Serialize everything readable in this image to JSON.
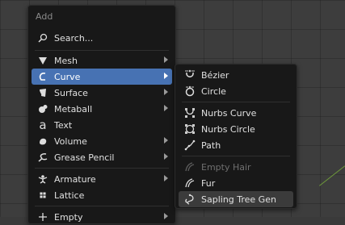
{
  "add_menu": {
    "header": "Add",
    "search_label": "Search...",
    "items": [
      {
        "label": "Mesh",
        "icon": "mesh-icon",
        "submenu": true
      },
      {
        "label": "Curve",
        "icon": "curve-icon",
        "submenu": true,
        "active": true
      },
      {
        "label": "Surface",
        "icon": "surface-icon",
        "submenu": true
      },
      {
        "label": "Metaball",
        "icon": "metaball-icon",
        "submenu": true
      },
      {
        "label": "Text",
        "icon": "text-icon",
        "submenu": false
      },
      {
        "label": "Volume",
        "icon": "volume-icon",
        "submenu": true
      },
      {
        "label": "Grease Pencil",
        "icon": "grease-pencil-icon",
        "submenu": true
      },
      {
        "label": "Armature",
        "icon": "armature-icon",
        "submenu": true
      },
      {
        "label": "Lattice",
        "icon": "lattice-icon",
        "submenu": false
      },
      {
        "label": "Empty",
        "icon": "empty-icon",
        "submenu": true
      }
    ]
  },
  "curve_menu": {
    "items": [
      {
        "label": "Bézier",
        "icon": "bezier-icon"
      },
      {
        "label": "Circle",
        "icon": "circle-curve-icon"
      },
      {
        "label": "Nurbs Curve",
        "icon": "nurbs-curve-icon"
      },
      {
        "label": "Nurbs Circle",
        "icon": "nurbs-circle-icon"
      },
      {
        "label": "Path",
        "icon": "path-icon"
      },
      {
        "label": "Empty Hair",
        "icon": "empty-hair-icon",
        "disabled": true
      },
      {
        "label": "Fur",
        "icon": "fur-icon"
      },
      {
        "label": "Sapling Tree Gen",
        "icon": "sapling-tree-icon",
        "hover": true
      }
    ]
  },
  "colors": {
    "menu_bg": "#181818",
    "active": "#4772b3",
    "hover": "#3b3b3b",
    "text": "#e0e0e0",
    "disabled_text": "#6f6f6f"
  }
}
